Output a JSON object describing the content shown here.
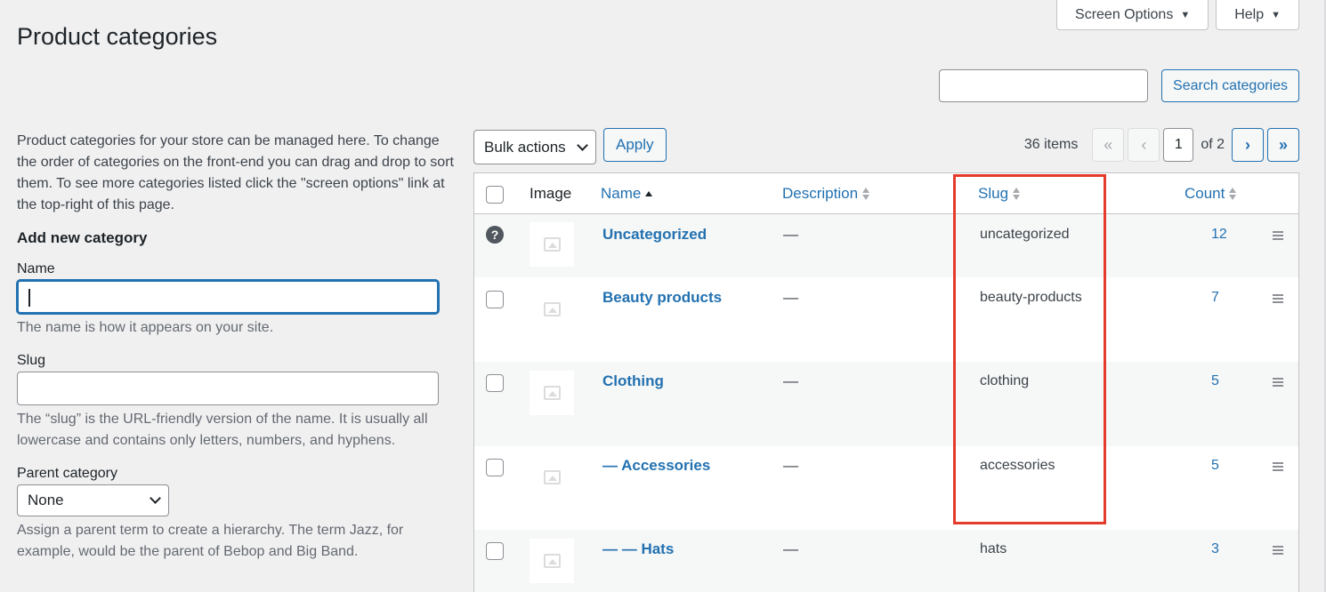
{
  "header": {
    "title": "Product categories",
    "screen_options_label": "Screen Options",
    "help_label": "Help"
  },
  "search": {
    "value": "",
    "placeholder": "",
    "button_label": "Search categories"
  },
  "form": {
    "intro": "Product categories for your store can be managed here. To change the order of categories on the front-end you can drag and drop to sort them. To see more categories listed click the \"screen options\" link at the top-right of this page.",
    "title": "Add new category",
    "name_label": "Name",
    "name_value": "",
    "name_help": "The name is how it appears on your site.",
    "slug_label": "Slug",
    "slug_value": "",
    "slug_help": "The “slug” is the URL-friendly version of the name. It is usually all lowercase and contains only letters, numbers, and hyphens.",
    "parent_label": "Parent category",
    "parent_value": "None",
    "parent_help": "Assign a parent term to create a hierarchy. The term Jazz, for example, would be the parent of Bebop and Big Band."
  },
  "tablenav": {
    "bulk_actions_label": "Bulk actions",
    "apply_label": "Apply",
    "items_count": "36 items",
    "first_page": "«",
    "prev_page": "‹",
    "current_page": "1",
    "of_pages": "of 2",
    "next_page": "›",
    "last_page": "»"
  },
  "table": {
    "columns": {
      "image": "Image",
      "name": "Name",
      "description": "Description",
      "slug": "Slug",
      "count": "Count"
    },
    "rows": [
      {
        "name": "Uncategorized",
        "description": "—",
        "slug": "uncategorized",
        "count": "12",
        "default": true
      },
      {
        "name": "Beauty products",
        "description": "—",
        "slug": "beauty-products",
        "count": "7"
      },
      {
        "name": "Clothing",
        "description": "—",
        "slug": "clothing",
        "count": "5"
      },
      {
        "name": "— Accessories",
        "description": "—",
        "slug": "accessories",
        "count": "5"
      },
      {
        "name": "— — Hats",
        "description": "—",
        "slug": "hats",
        "count": "3"
      }
    ]
  },
  "colors": {
    "accent": "#2271b1",
    "highlight": "#e53b2c",
    "background": "#f0f0f1"
  },
  "icons": {
    "default_category": "question-circle-icon",
    "thumbnail": "image-placeholder-icon",
    "drag": "drag-handle-icon"
  }
}
